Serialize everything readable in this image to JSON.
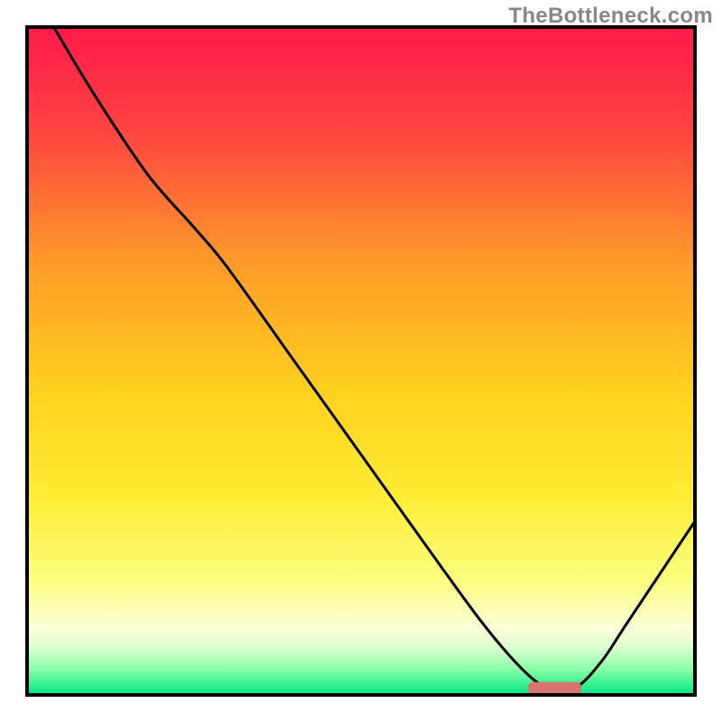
{
  "watermark": "TheBottleneck.com",
  "chart_data": {
    "type": "line",
    "title": "",
    "xlabel": "",
    "ylabel": "",
    "xlim": [
      0,
      100
    ],
    "ylim": [
      0,
      100
    ],
    "grid": false,
    "legend": false,
    "gradient_stops": [
      {
        "offset": 0.0,
        "color": "#ff1a4b"
      },
      {
        "offset": 0.15,
        "color": "#ff4141"
      },
      {
        "offset": 0.35,
        "color": "#ff9a2a"
      },
      {
        "offset": 0.55,
        "color": "#ffd21e"
      },
      {
        "offset": 0.7,
        "color": "#ffec33"
      },
      {
        "offset": 0.83,
        "color": "#fcff7f"
      },
      {
        "offset": 0.9,
        "color": "#fdffd9"
      },
      {
        "offset": 0.93,
        "color": "#d9ffcf"
      },
      {
        "offset": 0.96,
        "color": "#8dffa9"
      },
      {
        "offset": 1.0,
        "color": "#00e884"
      }
    ],
    "series": [
      {
        "name": "bottleneck-curve",
        "color": "#000000",
        "x": [
          4,
          10,
          18,
          25,
          30,
          40,
          50,
          60,
          68,
          74,
          78,
          82,
          86,
          90,
          100
        ],
        "y": [
          100,
          90,
          78,
          70,
          64,
          50,
          36,
          22,
          11,
          4,
          1,
          1,
          5,
          11,
          26
        ]
      }
    ],
    "marker": {
      "name": "optimal-range",
      "color": "#d9746e",
      "x_start": 75,
      "x_end": 83,
      "y": 1
    }
  }
}
